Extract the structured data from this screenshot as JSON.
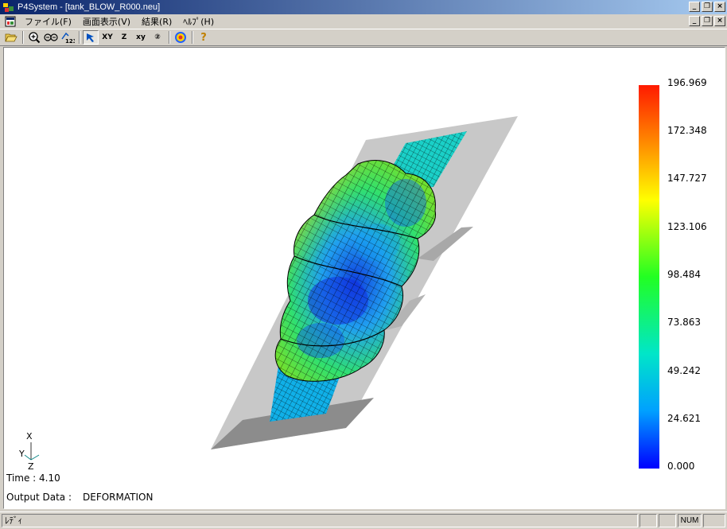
{
  "window": {
    "title": "P4System - [tank_BLOW_R000.neu]"
  },
  "window_controls": {
    "minimize": "_",
    "restore": "❐",
    "close": "×"
  },
  "menu": {
    "items": [
      "ファイル(F)",
      "画面表示(V)",
      "結果(R)",
      "ﾍﾙﾌﾟ(H)"
    ]
  },
  "toolbar": {
    "buttons": [
      {
        "name": "open-button",
        "icon": "folder-open-icon",
        "label": ""
      },
      {
        "name": "zoom-button",
        "icon": "zoom-in-icon",
        "label": ""
      },
      {
        "name": "fit-button",
        "icon": "fit-view-icon",
        "label": ""
      },
      {
        "name": "number-button",
        "icon": "numbering-icon",
        "label": ""
      },
      {
        "name": "select-button",
        "icon": "pointer-arrow-icon",
        "label": ""
      },
      {
        "name": "view-xy-button",
        "icon": "",
        "label": "XY"
      },
      {
        "name": "view-z-button",
        "icon": "",
        "label": "Z"
      },
      {
        "name": "view-xy-small-button",
        "icon": "",
        "label": "xy"
      },
      {
        "name": "view-2-button",
        "icon": "circled-2-icon",
        "label": "②"
      },
      {
        "name": "color-button",
        "icon": "color-wheel-icon",
        "label": ""
      },
      {
        "name": "help-button",
        "icon": "help-icon",
        "label": "?"
      }
    ]
  },
  "legend": {
    "labels": [
      "196.969",
      "172.348",
      "147.727",
      "123.106",
      "98.484",
      "73.863",
      "49.242",
      "24.621",
      "0.000"
    ],
    "max": 196.969,
    "min": 0.0
  },
  "axis": {
    "x": "X",
    "y": "Y",
    "z": "Z"
  },
  "info": {
    "time": "Time : 4.10",
    "output_label": "Output Data :",
    "output_value": "DEFORMATION"
  },
  "status": {
    "main": "ﾚﾃﾞｨ",
    "num": "NUM"
  },
  "colors": {
    "title_start": "#0a246a",
    "title_end": "#a6caf0",
    "face": "#d4d0c8"
  }
}
